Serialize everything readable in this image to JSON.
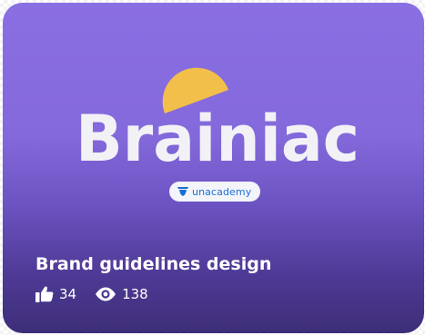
{
  "card": {
    "logo_text": "Brainiac",
    "badge": {
      "text": "unacademy",
      "icon": "unacademy-logo-icon"
    },
    "title": "Brand guidelines design",
    "stats": {
      "likes": {
        "icon": "thumbs-up-icon",
        "count": "34"
      },
      "views": {
        "icon": "eye-icon",
        "count": "138"
      }
    }
  },
  "colors": {
    "card_gradient_top": "#8a6fe3",
    "card_gradient_bottom": "#3d2e78",
    "logo_text": "#f2f2f6",
    "logo_sun": "#f2c04a",
    "badge_bg": "#f4f4fb",
    "badge_text": "#1a6fd1"
  }
}
